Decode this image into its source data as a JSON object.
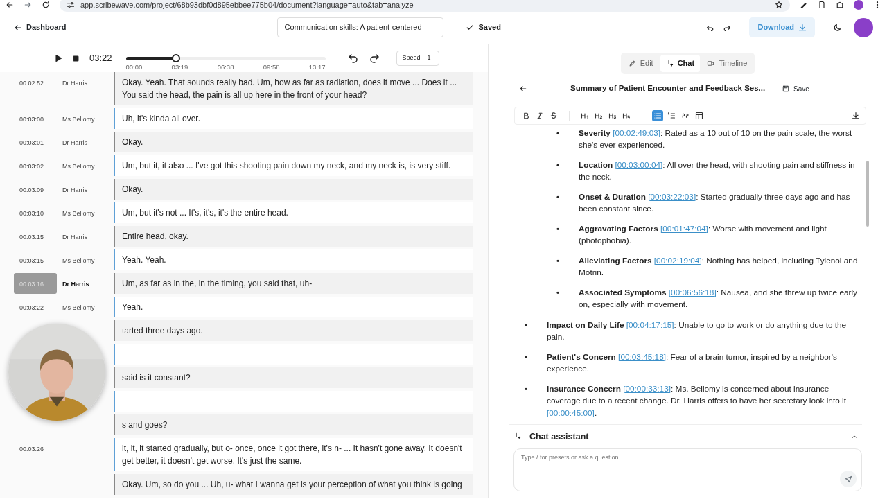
{
  "browser": {
    "url": "app.scribewave.com/project/68b93dbf0d895ebbee775b04/document?language=auto&tab=analyze"
  },
  "header": {
    "back_label": "Dashboard",
    "title_value": "Communication skills: A patient-centered",
    "saved_label": "Saved",
    "download_label": "Download"
  },
  "player": {
    "time": "03:22",
    "level": 0.25,
    "ticks": [
      "00:00",
      "03:19",
      "06:38",
      "09:58",
      "13:17"
    ],
    "speed_label": "Speed",
    "speed_value": "1"
  },
  "transcript": [
    {
      "time": "00:02:52",
      "speaker": "Dr Harris",
      "kind": "doctor",
      "selected": false,
      "text": "Okay. Yeah. That sounds really bad. Um, how as far as radiation, does it move ... Does it ... You said the head, the pain is all up here in the front of your head?"
    },
    {
      "time": "00:03:00",
      "speaker": "Ms Bellomy",
      "kind": "patient",
      "selected": false,
      "text": "Uh, it's kinda all over."
    },
    {
      "time": "00:03:01",
      "speaker": "Dr Harris",
      "kind": "doctor",
      "selected": false,
      "text": "Okay."
    },
    {
      "time": "00:03:02",
      "speaker": "Ms Bellomy",
      "kind": "patient",
      "selected": false,
      "text": "Um, but it, it also ... I've got this shooting pain down my neck, and my neck is, is very stiff."
    },
    {
      "time": "00:03:09",
      "speaker": "Dr Harris",
      "kind": "doctor",
      "selected": false,
      "text": "Okay."
    },
    {
      "time": "00:03:10",
      "speaker": "Ms Bellomy",
      "kind": "patient",
      "selected": false,
      "text": "Um, but it's not ... It's, it's, it's the entire head."
    },
    {
      "time": "00:03:15",
      "speaker": "Dr Harris",
      "kind": "doctor",
      "selected": false,
      "text": "Entire head, okay."
    },
    {
      "time": "00:03:15",
      "speaker": "Ms Bellomy",
      "kind": "patient",
      "selected": false,
      "text": "Yeah. Yeah."
    },
    {
      "time": "00:03:16",
      "speaker": "Dr Harris",
      "kind": "doctor",
      "selected": true,
      "text": "Um, as far as in the, in the timing, you said that, uh-"
    },
    {
      "time": "00:03:22",
      "speaker": "Ms Bellomy",
      "kind": "patient",
      "selected": false,
      "text": "Yeah."
    },
    {
      "kind": "doctor",
      "text": "tarted three days ago."
    },
    {
      "kind": "patient"
    },
    {
      "kind": "doctor",
      "text": "said is it constant?"
    },
    {
      "kind": "patient"
    },
    {
      "kind": "doctor",
      "text": "s and goes?"
    },
    {
      "time": "00:03:26",
      "kind": "patient",
      "selected": false,
      "text": "it, it, it started gradually, but o- once, once it got there, it's n- ... It hasn't gone away. It doesn't get better, it doesn't get worse. It's just the same."
    },
    {
      "kind": "doctor",
      "selected": false,
      "text": "Okay. Um, so do you ... Uh, u- what I wanna get is your perception of what you think is going"
    }
  ],
  "view_tabs": [
    {
      "label": "Edit",
      "selected": false
    },
    {
      "label": "Chat",
      "selected": true
    },
    {
      "label": "Timeline",
      "selected": false
    }
  ],
  "document": {
    "title": "Summary of Patient Encounter and Feedback Ses...",
    "save_label": "Save"
  },
  "toolbar": [
    {
      "kind": "bold",
      "selected": false
    },
    {
      "kind": "italic",
      "selected": false
    },
    {
      "kind": "strike",
      "selected": false
    },
    {
      "kind": "h1",
      "selected": false
    },
    {
      "kind": "h2",
      "selected": false
    },
    {
      "kind": "h3",
      "selected": false
    },
    {
      "kind": "h4",
      "selected": false
    },
    {
      "kind": "bullets",
      "selected": true
    },
    {
      "kind": "numbers",
      "selected": false
    },
    {
      "kind": "quote",
      "selected": false
    },
    {
      "kind": "table",
      "selected": false
    }
  ],
  "summary": {
    "items": [
      {
        "children": [
          {
            "bullet": "•",
            "parts": [
              {
                "kind": "label",
                "text": "Severity"
              },
              {
                "kind": "link",
                "text": "[00:02:49:03]"
              },
              {
                "kind": "text",
                "text": ": Rated as a 10 out of 10 on the pain scale, the worst she's ever experienced."
              }
            ]
          },
          {
            "bullet": "•",
            "parts": [
              {
                "kind": "label",
                "text": "Location"
              },
              {
                "kind": "link",
                "text": "[00:03:00:04]"
              },
              {
                "kind": "text",
                "text": ": All over the head, with shooting pain and stiffness in the neck."
              }
            ]
          },
          {
            "bullet": "•",
            "parts": [
              {
                "kind": "label",
                "text": "Onset & Duration"
              },
              {
                "kind": "link",
                "text": "[00:03:22:03]"
              },
              {
                "kind": "text",
                "text": ": Started gradually three days ago and has been constant since."
              }
            ]
          },
          {
            "bullet": "•",
            "parts": [
              {
                "kind": "label",
                "text": "Aggravating Factors"
              },
              {
                "kind": "link",
                "text": "[00:01:47:04]"
              },
              {
                "kind": "text",
                "text": ": Worse with movement and light (photophobia)."
              }
            ]
          },
          {
            "bullet": "•",
            "parts": [
              {
                "kind": "label",
                "text": "Alleviating Factors"
              },
              {
                "kind": "link",
                "text": "[00:02:19:04]"
              },
              {
                "kind": "text",
                "text": ": Nothing has helped, including Tylenol and Motrin."
              }
            ]
          },
          {
            "bullet": "•",
            "parts": [
              {
                "kind": "label",
                "text": "Associated Symptoms"
              },
              {
                "kind": "link",
                "text": "[00:06:56:18]"
              },
              {
                "kind": "text",
                "text": ": Nausea, and she threw up twice early on, especially with movement."
              }
            ]
          }
        ]
      },
      {
        "bullet": "•",
        "parts": [
          {
            "kind": "label",
            "text": "Impact on Daily Life"
          },
          {
            "kind": "link",
            "text": "[00:04:17:15]"
          },
          {
            "kind": "text",
            "text": ": Unable to go to work or do anything due to the pain."
          }
        ]
      },
      {
        "bullet": "•",
        "parts": [
          {
            "kind": "label",
            "text": "Patient's Concern"
          },
          {
            "kind": "link",
            "text": "[00:03:45:18]"
          },
          {
            "kind": "text",
            "text": ": Fear of a brain tumor, inspired by a neighbor's experience."
          }
        ]
      },
      {
        "bullet": "•",
        "parts": [
          {
            "kind": "label",
            "text": "Insurance Concern"
          },
          {
            "kind": "link",
            "text": "[00:00:33:13]"
          },
          {
            "kind": "text",
            "text": ": Ms. Bellomy is concerned about insurance coverage due to a recent change. Dr. Harris offers to have her secretary look into it "
          },
          {
            "kind": "link",
            "text": "[00:00:45:00]"
          },
          {
            "kind": "text",
            "text": "."
          }
        ]
      }
    ]
  },
  "chat": {
    "title": "Chat assistant",
    "expanded": true,
    "placeholder": "Type / for presets or ask a question..."
  }
}
